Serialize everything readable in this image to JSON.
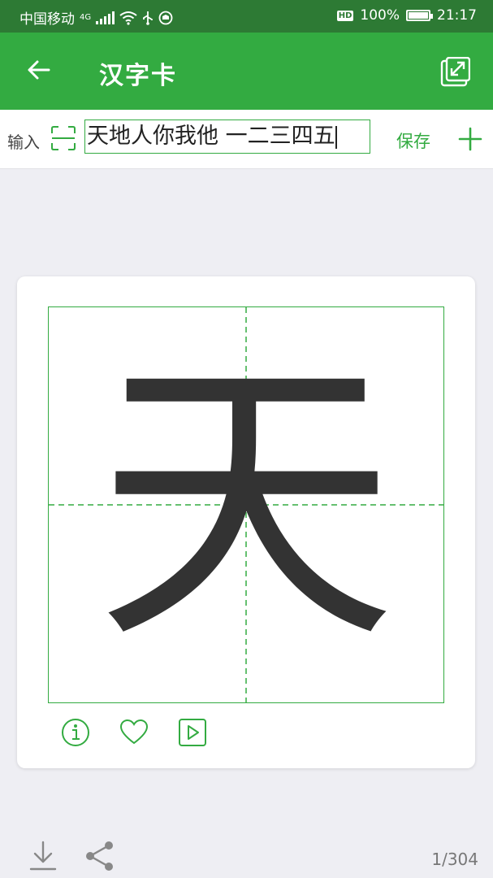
{
  "status_bar": {
    "carrier": "中国移动",
    "network": "4G",
    "battery_percent": "100%",
    "time": "21:17",
    "hd_label": "HD"
  },
  "app_bar": {
    "title": "汉字卡",
    "icons": [
      "arrow-left-icon",
      "expand-icon"
    ]
  },
  "input_bar": {
    "label": "输入",
    "value": "天地人你我他 一二三四五",
    "save_label": "保存",
    "icons": [
      "scan-icon",
      "plus-icon"
    ]
  },
  "card": {
    "character": "天",
    "icons": [
      "info-icon",
      "heart-icon",
      "play-icon"
    ]
  },
  "bottom": {
    "page_indicator": "1/304",
    "icons": [
      "download-icon",
      "share-icon"
    ]
  },
  "colors": {
    "primary": "#33ab41",
    "status_bar": "#2d7a34",
    "background": "#eeeef3",
    "character": "#333333"
  }
}
